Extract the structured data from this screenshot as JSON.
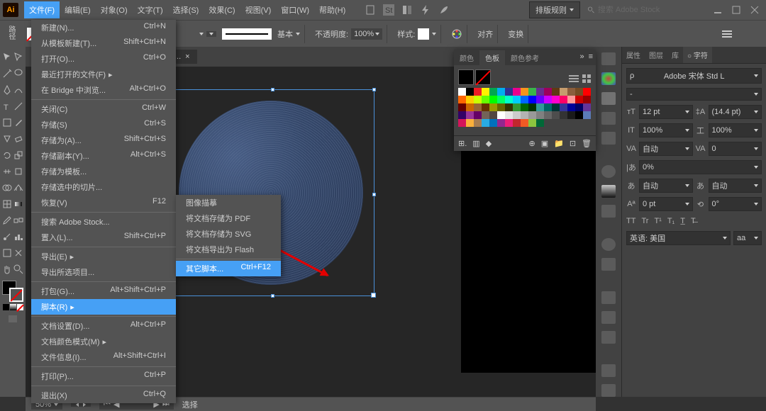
{
  "menubar": {
    "items": [
      "文件(F)",
      "编辑(E)",
      "对象(O)",
      "文字(T)",
      "选择(S)",
      "效果(C)",
      "视图(V)",
      "窗口(W)",
      "帮助(H)"
    ]
  },
  "titlebar": {
    "layout_label": "排版规则",
    "search_placeholder": "搜索 Adobe Stock"
  },
  "control": {
    "opacity_label": "不透明度:",
    "opacity_value": "100%",
    "style_label": "样式:",
    "align_label": "对齐",
    "transform_label": "变换",
    "stroke_preset": "基本"
  },
  "left_label": "路径",
  "tab": {
    "title": "...",
    "close": "×"
  },
  "file_menu": [
    {
      "label": "新建(N)...",
      "sc": "Ctrl+N"
    },
    {
      "label": "从模板新建(T)...",
      "sc": "Shift+Ctrl+N"
    },
    {
      "label": "打开(O)...",
      "sc": "Ctrl+O"
    },
    {
      "label": "最近打开的文件(F)",
      "sc": "",
      "sub": true
    },
    {
      "label": "在 Bridge 中浏览...",
      "sc": "Alt+Ctrl+O"
    },
    {
      "sep": true
    },
    {
      "label": "关闭(C)",
      "sc": "Ctrl+W"
    },
    {
      "label": "存储(S)",
      "sc": "Ctrl+S"
    },
    {
      "label": "存储为(A)...",
      "sc": "Shift+Ctrl+S"
    },
    {
      "label": "存储副本(Y)...",
      "sc": "Alt+Ctrl+S"
    },
    {
      "label": "存储为模板...",
      "sc": ""
    },
    {
      "label": "存储选中的切片...",
      "sc": ""
    },
    {
      "label": "恢复(V)",
      "sc": "F12"
    },
    {
      "sep": true
    },
    {
      "label": "搜索 Adobe Stock...",
      "sc": ""
    },
    {
      "label": "置入(L)...",
      "sc": "Shift+Ctrl+P"
    },
    {
      "sep": true
    },
    {
      "label": "导出(E)",
      "sc": "",
      "sub": true
    },
    {
      "label": "导出所选项目...",
      "sc": ""
    },
    {
      "sep": true
    },
    {
      "label": "打包(G)...",
      "sc": "Alt+Shift+Ctrl+P"
    },
    {
      "label": "脚本(R)",
      "sc": "",
      "sub": true,
      "hover": true
    },
    {
      "sep": true
    },
    {
      "label": "文档设置(D)...",
      "sc": "Alt+Ctrl+P"
    },
    {
      "label": "文档颜色模式(M)",
      "sc": "",
      "sub": true
    },
    {
      "label": "文件信息(I)...",
      "sc": "Alt+Shift+Ctrl+I"
    },
    {
      "sep": true
    },
    {
      "label": "打印(P)...",
      "sc": "Ctrl+P"
    },
    {
      "sep": true
    },
    {
      "label": "退出(X)",
      "sc": "Ctrl+Q"
    }
  ],
  "script_submenu": [
    {
      "label": "图像描摹",
      "sc": ""
    },
    {
      "label": "将文档存储为 PDF",
      "sc": ""
    },
    {
      "label": "将文档存储为 SVG",
      "sc": ""
    },
    {
      "label": "将文档导出为 Flash",
      "sc": ""
    },
    {
      "sep": true
    },
    {
      "label": "其它脚本...",
      "sc": "Ctrl+F12",
      "hover": true
    }
  ],
  "swatches": {
    "tabs": [
      "颜色",
      "色板",
      "颜色参考"
    ],
    "colors": [
      "#ffffff",
      "#000000",
      "#ed1c24",
      "#fff200",
      "#00a651",
      "#00aeef",
      "#2e3192",
      "#ec008c",
      "#f7941d",
      "#39b54a",
      "#662d91",
      "#9e005d",
      "#603913",
      "#c69c6d",
      "#8b5e3c",
      "#754c24",
      "#ff0000",
      "#ff6600",
      "#ffcc00",
      "#ccff00",
      "#66ff00",
      "#00ff00",
      "#00ff66",
      "#00ffcc",
      "#00ccff",
      "#0066ff",
      "#0000ff",
      "#6600ff",
      "#cc00ff",
      "#ff00cc",
      "#ff0066",
      "#ff9999",
      "#cc0000",
      "#990000",
      "#660000",
      "#cc6600",
      "#996633",
      "#663300",
      "#999900",
      "#666600",
      "#333300",
      "#339933",
      "#006600",
      "#003300",
      "#339999",
      "#006666",
      "#003333",
      "#333399",
      "#000099",
      "#000066",
      "#663399",
      "#330066",
      "#993399",
      "#660066",
      "#736357",
      "#534741",
      "#ffffff",
      "#e6e6e6",
      "#cccccc",
      "#b3b3b3",
      "#999999",
      "#808080",
      "#666666",
      "#4d4d4d",
      "#333333",
      "#1a1a1a",
      "#000000",
      "#5a7bb8",
      "#d4145a",
      "#fbb03b",
      "#a67c52",
      "#29abe2",
      "#0071bc",
      "#93278f",
      "#ed1e79",
      "#c1272d",
      "#f15a24",
      "#8cc63f",
      "#006837"
    ]
  },
  "char_panel": {
    "tabs": [
      "属性",
      "图层",
      "库",
      "○ 字符"
    ],
    "font": "Adobe 宋体 Std L",
    "style": "-",
    "size": "12 pt",
    "leading": "(14.4 pt)",
    "scale_v": "100%",
    "scale_h": "100%",
    "va": "自动",
    "tracking": "0",
    "baseline": "0%",
    "tsume": "自动",
    "baseline_shift": "0 pt",
    "rotation": "0°",
    "lang": "英语: 美国",
    "aa": "aa"
  },
  "statusbar": {
    "zoom": "50%",
    "select_label": "选择"
  }
}
